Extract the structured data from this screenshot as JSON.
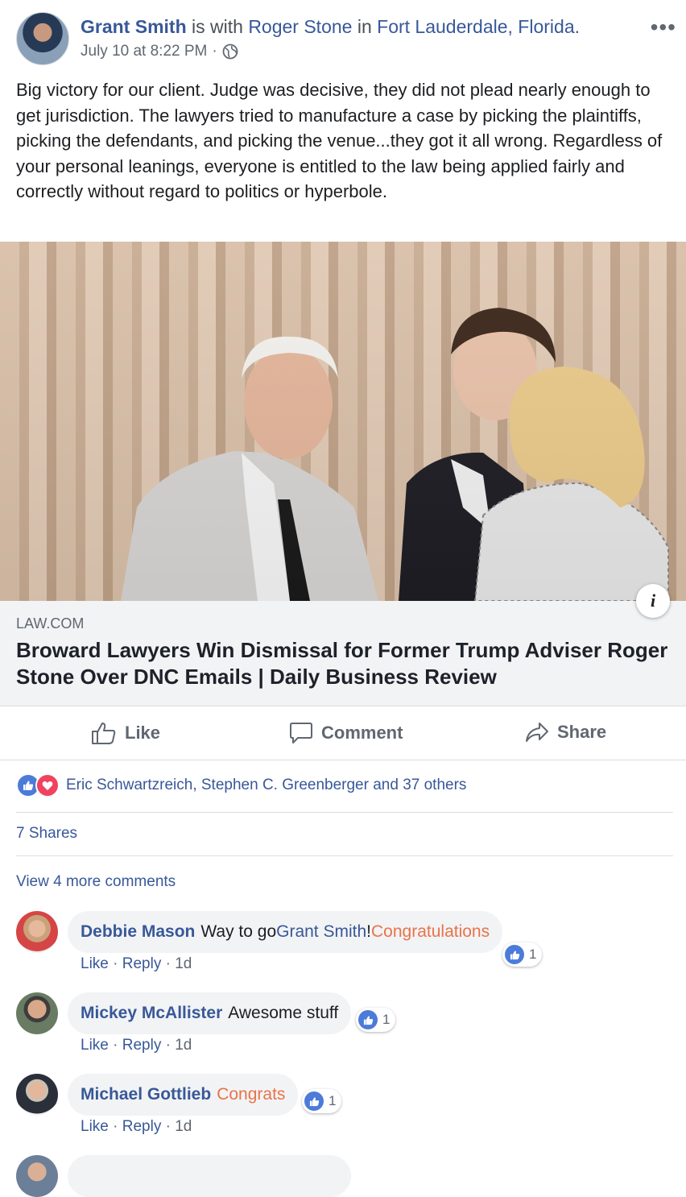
{
  "post": {
    "author": "Grant Smith",
    "with_word": " is with ",
    "tagged": "Roger Stone",
    "in_word": " in ",
    "location": "Fort Lauderdale, Florida.",
    "timestamp": "July 10 at 8:22 PM",
    "separator": "·",
    "privacy_icon": "globe-icon",
    "more_options": "•••",
    "text": "Big victory for our client. Judge was decisive, they did not plead nearly enough to get jurisdiction. The lawyers tried to manufacture a case by picking the plaintiffs, picking the defendants, and picking the venue...they got it all wrong. Regardless of your personal leanings, everyone is entitled to the law being applied fairly and correctly without regard to politics or hyperbole."
  },
  "link_preview": {
    "domain": "LAW.COM",
    "title": "Broward Lawyers Win Dismissal for Former Trump Adviser Roger Stone Over DNC Emails | Daily Business Review",
    "info_glyph": "i"
  },
  "actions": {
    "like": "Like",
    "comment": "Comment",
    "share": "Share"
  },
  "reactions": {
    "names": "Eric Schwartzreich, Stephen C. Greenberger and 37 others",
    "types": [
      "like",
      "love"
    ]
  },
  "shares_text": "7 Shares",
  "view_more": "View 4 more comments",
  "comments": [
    {
      "name": "Debbie Mason",
      "text": "Way to go ",
      "mention": "Grant Smith",
      "after": "! ",
      "accent": "Congratulations",
      "like_label": "Like",
      "reply_label": "Reply",
      "age": "1d",
      "like_count": "1"
    },
    {
      "name": "Mickey McAllister",
      "text": "Awesome stuff",
      "like_label": "Like",
      "reply_label": "Reply",
      "age": "1d",
      "like_count": "1"
    },
    {
      "name": "Michael Gottlieb",
      "accent": "Congrats",
      "like_label": "Like",
      "reply_label": "Reply",
      "age": "1d",
      "like_count": "1"
    }
  ],
  "colors": {
    "link": "#385898",
    "accent": "#e9734a",
    "like_blue": "#4c7bd9",
    "love_red": "#f0435f"
  }
}
